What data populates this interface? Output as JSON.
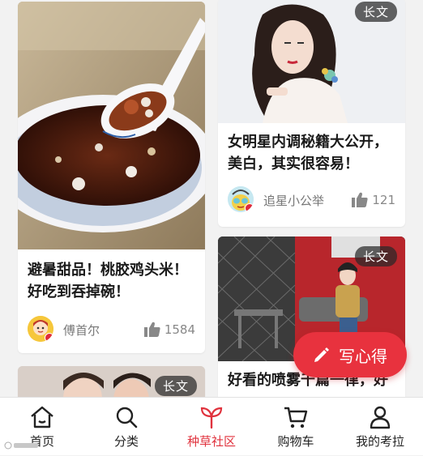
{
  "feed": {
    "cards": [
      {
        "title": "避暑甜品！桃胶鸡头米！好吃到吞掉碗！",
        "author": "傅首尔",
        "likes": "1584",
        "avatar_icon": "user-avatar-icon"
      },
      {
        "badge": "长文",
        "title": "女明星内调秘籍大公开，美白，其实很容易！",
        "author": "追星小公举",
        "likes": "121",
        "avatar_icon": "user-avatar-icon"
      },
      {
        "badge": "长文",
        "title": "好看的喷雾千篇一律，好"
      },
      {
        "badge": "长文"
      }
    ]
  },
  "fab": {
    "label": "写心得",
    "icon": "pencil-icon"
  },
  "tabbar": {
    "active_color": "#e0323d",
    "items": [
      {
        "label": "首页",
        "icon": "home-icon"
      },
      {
        "label": "分类",
        "icon": "search-icon"
      },
      {
        "label": "种草社区",
        "icon": "sprout-icon",
        "active": true
      },
      {
        "label": "购物车",
        "icon": "cart-icon"
      },
      {
        "label": "我的考拉",
        "icon": "profile-icon"
      }
    ]
  },
  "colors": {
    "accent": "#e8323e",
    "background": "#f2f2f2"
  }
}
